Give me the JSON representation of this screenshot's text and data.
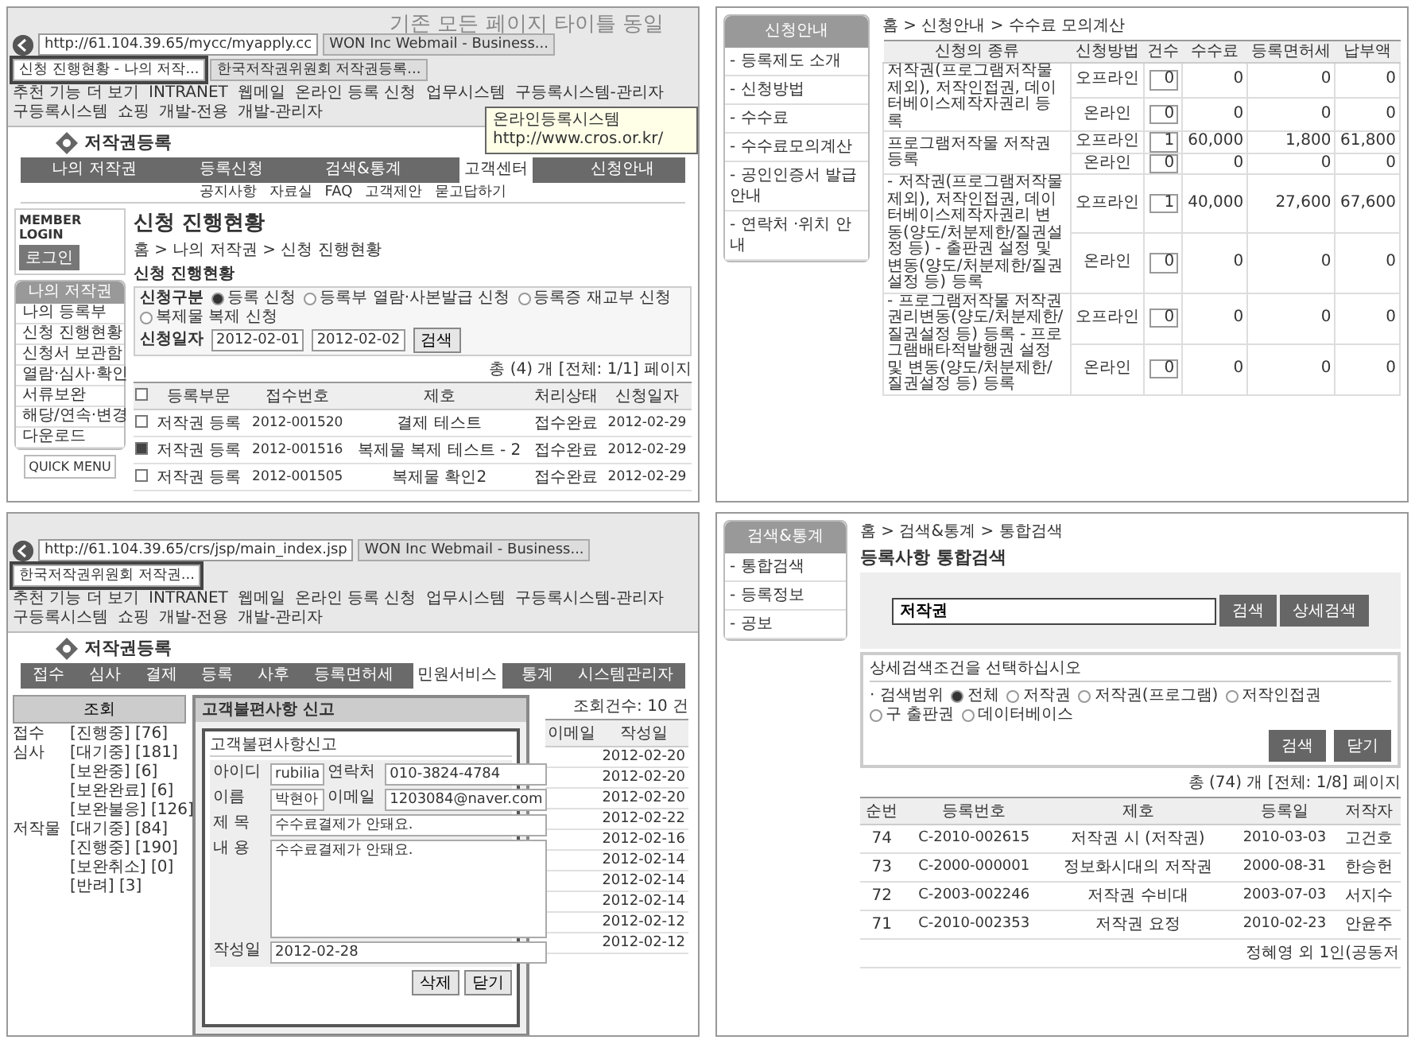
{
  "annotation": "기존 모든 페이지 타이틀 동일",
  "apply_status": {
    "browser": {
      "address": "http://61.104.39.65/mycc/myapply.cc",
      "tabs": [
        {
          "label": "WON Inc Webmail - Business...",
          "selected": false
        },
        {
          "label": "신청 진행현황 - 나의 저작...",
          "selected": true
        },
        {
          "label": "한국저작권위원회 저작권등록...",
          "selected": false
        }
      ],
      "favorites": [
        "추천 기능 더 보기",
        "INTRANET",
        "웹메일",
        "온라인 등록 신청",
        "업무시스템",
        "구등록시스템-관리자",
        "구등록시스템",
        "쇼핑",
        "개발-전용",
        "개발-관리자"
      ],
      "tooltip": "온라인등록시스템 http://www.cros.or.kr/"
    },
    "logo": "저작권등록",
    "nav": [
      {
        "label": "나의 저작권",
        "selected": false
      },
      {
        "label": "등록신청",
        "selected": false
      },
      {
        "label": "검색&통계",
        "selected": false
      },
      {
        "label": "고객센터",
        "selected": true
      },
      {
        "label": "신청안내",
        "selected": false
      }
    ],
    "subnav": [
      "공지사항",
      "자료실",
      "FAQ",
      "고객제안",
      "묻고답하기"
    ],
    "login": {
      "title": "MEMBER LOGIN",
      "button": "로그인"
    },
    "menu_title": "나의 저작권",
    "menu": [
      "나의 등록부",
      "신청 진행현황",
      "신청서 보관함",
      "열람·심사·확인",
      "서류보완",
      "해당/연속·변경",
      "다운로드"
    ],
    "quick_menu": "QUICK MENU",
    "page_title": "신청 진행현황",
    "breadcrumb": "홈 > 나의 저작권 > 신청 진행현황",
    "section": "신청 진행현황",
    "type_label": "신청구분",
    "types": [
      {
        "label": "등록 신청",
        "selected": true
      },
      {
        "label": "등록부 열람·사본발급 신청",
        "selected": false
      },
      {
        "label": "등록증 재교부 신청",
        "selected": false
      },
      {
        "label": "복제물 복제 신청",
        "selected": false
      }
    ],
    "date_label": "신청일자",
    "date_from": "2012-02-01",
    "date_to": "2012-02-02",
    "search_button": "검색",
    "count": "총 (4) 개 [전체: 1/1] 페이지",
    "all_checked": false,
    "columns": [
      "등록부문",
      "접수번호",
      "제호",
      "처리상태",
      "신청일자"
    ],
    "rows": [
      {
        "checked": false,
        "cells": [
          "저작권 등록",
          "2012-001520",
          "결제 테스트",
          "접수완료",
          "2012-02-29"
        ]
      },
      {
        "checked": true,
        "cells": [
          "저작권 등록",
          "2012-001516",
          "복제물 복제 테스트 - 2",
          "접수완료",
          "2012-02-29"
        ]
      },
      {
        "checked": false,
        "cells": [
          "저작권 등록",
          "2012-001505",
          "복제물 확인2",
          "접수완료",
          "2012-02-29"
        ]
      }
    ]
  },
  "fee_calc": {
    "menu_title": "신청안내",
    "menu": [
      "- 등록제도 소개",
      "- 신청방법",
      "- 수수료",
      "- 수수료모의계산",
      "- 공인인증서 발급안내",
      "- 연락처 ·위치 안내"
    ],
    "breadcrumb": "홈 > 신청안내 > 수수료 모의계산",
    "columns": [
      "신청의 종류",
      "신청방법",
      "건수",
      "수수료",
      "등록면허세",
      "납부액"
    ],
    "groups": [
      {
        "kind": "저작권(프로그램저작물 제외), 저작인접권, 데이터베이스제작자권리 등록",
        "rows": [
          {
            "method": "오프라인",
            "count": "0",
            "fee": "0",
            "tax": "0",
            "total": "0"
          },
          {
            "method": "온라인",
            "count": "0",
            "fee": "0",
            "tax": "0",
            "total": "0"
          }
        ]
      },
      {
        "kind": "프로그램저작물 저작권 등록",
        "rows": [
          {
            "method": "오프라인",
            "count": "1",
            "fee": "60,000",
            "tax": "1,800",
            "total": "61,800"
          },
          {
            "method": "온라인",
            "count": "0",
            "fee": "0",
            "tax": "0",
            "total": "0"
          }
        ]
      },
      {
        "kind": "- 저작권(프로그램저작물 제외), 저작인접권, 데이터베이스제작자권리 변동(양도/처분제한/질권설정 등) - 출판권 설정 및 변동(양도/처분제한/질권설정 등) 등록",
        "rows": [
          {
            "method": "오프라인",
            "count": "1",
            "fee": "40,000",
            "tax": "27,600",
            "total": "67,600"
          },
          {
            "method": "온라인",
            "count": "0",
            "fee": "0",
            "tax": "0",
            "total": "0"
          }
        ]
      },
      {
        "kind": "- 프로그램저작물 저작권 권리변동(양도/처분제한/질권설정 등) 등록 - 프로그램배타적발행권 설정 및 변동(양도/처분제한/질권설정 등) 등록",
        "rows": [
          {
            "method": "오프라인",
            "count": "0",
            "fee": "0",
            "tax": "0",
            "total": "0"
          },
          {
            "method": "온라인",
            "count": "0",
            "fee": "0",
            "tax": "0",
            "total": "0"
          }
        ]
      }
    ]
  },
  "complaint": {
    "browser": {
      "address": "http://61.104.39.65/crs/jsp/main_index.jsp",
      "tabs": [
        {
          "label": "WON Inc Webmail - Business...",
          "selected": false
        },
        {
          "label": "한국저작권위원회 저작권...",
          "selected": true
        }
      ],
      "favorites": [
        "추천 기능 더 보기",
        "INTRANET",
        "웹메일",
        "온라인 등록 신청",
        "업무시스템",
        "구등록시스템-관리자",
        "구등록시스템",
        "쇼핑",
        "개발-전용",
        "개발-관리자"
      ]
    },
    "logo": "저작권등록",
    "nav": [
      {
        "label": "접수",
        "selected": false
      },
      {
        "label": "심사",
        "selected": false
      },
      {
        "label": "결제",
        "selected": false
      },
      {
        "label": "등록",
        "selected": false
      },
      {
        "label": "사후",
        "selected": false
      },
      {
        "label": "등록면허세",
        "selected": false
      },
      {
        "label": "민원서비스",
        "selected": true
      },
      {
        "label": "통계",
        "selected": false
      },
      {
        "label": "시스템관리자",
        "selected": false
      }
    ],
    "lookup_button": "조회",
    "status": [
      {
        "group": "접수",
        "items": [
          {
            "label": "[진행중]",
            "count": "[76]"
          }
        ]
      },
      {
        "group": "심사",
        "items": [
          {
            "label": "[대기중]",
            "count": "[181]"
          },
          {
            "label": "[보완중]",
            "count": "[6]"
          },
          {
            "label": "[보완완료]",
            "count": "[6]"
          },
          {
            "label": "[보완불응]",
            "count": "[126]"
          }
        ]
      },
      {
        "group": "저작물",
        "items": [
          {
            "label": "[대기중]",
            "count": "[84]"
          },
          {
            "label": "[진행중]",
            "count": "[190]"
          },
          {
            "label": "[보완취소]",
            "count": "[0]"
          },
          {
            "label": "[반려]",
            "count": "[3]"
          }
        ]
      }
    ],
    "total": "조회건수: 10 건",
    "list_columns": [
      "이메일",
      "작성일"
    ],
    "list_dates": [
      "2012-02-20",
      "2012-02-20",
      "2012-02-20",
      "2012-02-22",
      "2012-02-16",
      "2012-02-14",
      "2012-02-14",
      "2012-02-14",
      "2012-02-12",
      "2012-02-12"
    ],
    "dialog": {
      "title": "고객불편사항 신고",
      "heading": "고객불편사항신고",
      "fields": {
        "id_label": "아이디",
        "id": "rubilia",
        "phone_label": "연락처",
        "phone": "010-3824-4784",
        "name_label": "이름",
        "name": "박현아",
        "email_label": "이메일",
        "email": "1203084@naver.com",
        "subject_label": "제 목",
        "subject": "수수료결제가 안돼요.",
        "body_label": "내 용",
        "body": "수수료결제가 안돼요.",
        "date_label": "작성일",
        "date": "2012-02-28"
      },
      "buttons": [
        "삭제",
        "닫기"
      ]
    }
  },
  "search": {
    "menu_title": "검색&통계",
    "menu": [
      "- 통합검색",
      "- 등록정보",
      "- 공보"
    ],
    "breadcrumb": "홈 > 검색&통계 > 통합검색",
    "heading": "등록사항 통합검색",
    "query": "저작권",
    "search_button": "검색",
    "detail_button": "상세검색",
    "detail_title": "상세검색조건을 선택하십시오",
    "scope_label": "· 검색범위",
    "scopes": [
      {
        "label": "전체",
        "selected": true
      },
      {
        "label": "저작권",
        "selected": false
      },
      {
        "label": "저작권(프로그램)",
        "selected": false
      },
      {
        "label": "저작인접권",
        "selected": false
      },
      {
        "label": "구 출판권",
        "selected": false
      },
      {
        "label": "데이터베이스",
        "selected": false
      }
    ],
    "buttons": [
      "검색",
      "닫기"
    ],
    "count": "총 (74) 개 [전체: 1/8] 페이지",
    "columns": [
      "순번",
      "등록번호",
      "제호",
      "등록일",
      "저작자"
    ],
    "rows": [
      [
        "74",
        "C-2010-002615",
        "저작권 시 (저작권)",
        "2010-03-03",
        "고건호"
      ],
      [
        "73",
        "C-2000-000001",
        "정보화시대의 저작권",
        "2000-08-31",
        "한승헌"
      ],
      [
        "72",
        "C-2003-002246",
        "저작권 수비대",
        "2003-07-03",
        "서지수"
      ],
      [
        "71",
        "C-2010-002353",
        "저작권 요정",
        "2010-02-23",
        "안윤주"
      ]
    ],
    "partial_author": "정혜영 외 1인(공동저"
  }
}
